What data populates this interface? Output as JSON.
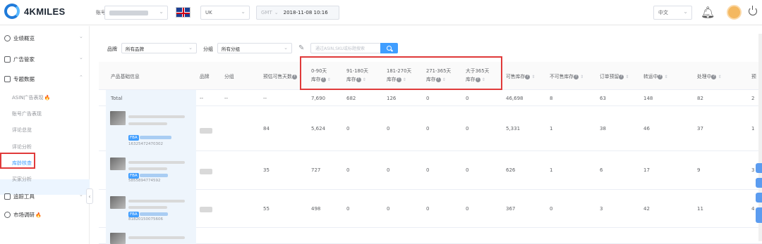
{
  "app": {
    "logo_text": "4KMILES"
  },
  "topbar": {
    "account_label": "账号",
    "marketplace_value": "UK",
    "timezone_prefix": "GMT",
    "timezone_datetime": "2018-11-08 10:16",
    "language_value": "中文"
  },
  "sidebar": {
    "items": [
      {
        "label": "业绩概览",
        "icon": "chart-circle-icon"
      },
      {
        "label": "广告管家",
        "icon": "ad-icon"
      },
      {
        "label": "专题数据",
        "icon": "doc-icon"
      },
      {
        "label": "追踪工具",
        "icon": "track-icon"
      },
      {
        "label": "市场调研",
        "icon": "target-icon",
        "hot": "🔥"
      }
    ],
    "subitems": [
      {
        "label": "ASIN广告表现",
        "hot": "🔥"
      },
      {
        "label": "账号广告表现"
      },
      {
        "label": "评论总览"
      },
      {
        "label": "评论分析"
      },
      {
        "label": "库龄核查",
        "active": true
      },
      {
        "label": "买家分析"
      }
    ]
  },
  "filters": {
    "brand_label": "品牌",
    "brand_value": "所有品牌",
    "group_label": "分组",
    "group_value": "所有分组",
    "search_placeholder": "通过ASIN,SKU或标题搜索"
  },
  "table": {
    "headers": {
      "product": "产品基础信息",
      "brand": "品牌",
      "group": "分组",
      "sell_days": "预估可售天数",
      "age_0_90_top": "0-90天",
      "age_0_90_bottom": "库存",
      "age_91_180_top": "91-180天",
      "age_91_180_bottom": "库存",
      "age_181_270_top": "181-270天",
      "age_181_270_bottom": "库存",
      "age_271_365_top": "271-365天",
      "age_271_365_bottom": "库存",
      "age_365_top": "大于365天",
      "age_365_bottom": "库存",
      "sellable": "可售库存",
      "unsellable": "不可售库存",
      "reserved": "订单预留",
      "transfer": "转运中",
      "processing": "处理中",
      "extra": "预"
    },
    "total": {
      "label": "Total",
      "brand": "--",
      "group": "--",
      "days": "--",
      "a0": "7,690",
      "a1": "682",
      "a2": "126",
      "a3": "0",
      "a4": "0",
      "sellable": "46,698",
      "unsellable": "8",
      "reserved": "63",
      "transfer": "148",
      "processing": "82",
      "extra": "2"
    },
    "rows": [
      {
        "asin": "16325472470302",
        "fba": "FBA",
        "days": "84",
        "a0": "5,624",
        "a1": "0",
        "a2": "0",
        "a3": "0",
        "a4": "0",
        "sellable": "5,331",
        "unsellable": "1",
        "reserved": "38",
        "transfer": "46",
        "processing": "37",
        "extra": "1"
      },
      {
        "asin": "5855894774592",
        "fba": "FBA",
        "days": "35",
        "a0": "727",
        "a1": "0",
        "a2": "0",
        "a3": "0",
        "a4": "0",
        "sellable": "626",
        "unsellable": "1",
        "reserved": "6",
        "transfer": "17",
        "processing": "9",
        "extra": "3"
      },
      {
        "asin": "81820150075606",
        "fba": "FBA",
        "days": "55",
        "a0": "498",
        "0": "0",
        "a1": "0",
        "a2": "0",
        "a3": "0",
        "a4": "0",
        "sellable": "367",
        "unsellable": "0",
        "reserved": "3",
        "transfer": "42",
        "processing": "11",
        "extra": "4"
      }
    ]
  },
  "colors": {
    "accent": "#409eff",
    "highlight_box": "#e03a3a",
    "active_bg": "#ecf5ff"
  }
}
